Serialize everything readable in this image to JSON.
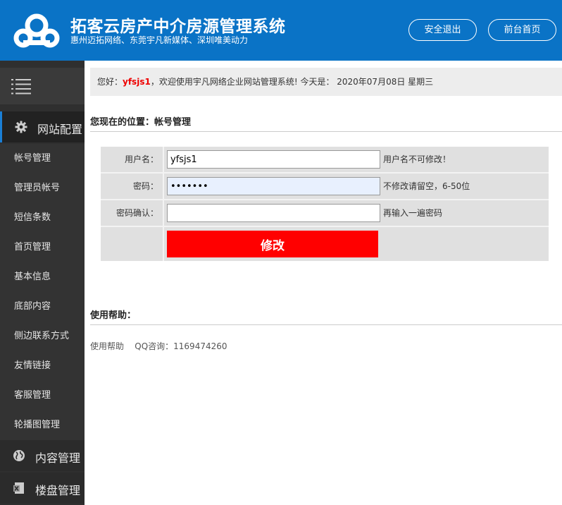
{
  "header": {
    "title": "拓客云房产中介房源管理系统",
    "subtitle": "惠州迈拓网络、东莞宇凡新媒体、深圳唯美动力",
    "logout_label": "安全退出",
    "home_label": "前台首页",
    "logo_icon": "cloud-logo-icon",
    "bg_color": "#0a73c6"
  },
  "sidebar": {
    "menu_icon": "hamburger-menu-icon",
    "config_section": {
      "label": "网站配置",
      "icon": "gear-icon"
    },
    "items": [
      {
        "label": "帐号管理"
      },
      {
        "label": "管理员帐号"
      },
      {
        "label": "短信条数"
      },
      {
        "label": "首页管理"
      },
      {
        "label": "基本信息"
      },
      {
        "label": "底部内容"
      },
      {
        "label": "侧边联系方式"
      },
      {
        "label": "友情链接"
      },
      {
        "label": "客服管理"
      },
      {
        "label": "轮播图管理"
      }
    ],
    "content_section": {
      "label": "内容管理",
      "icon": "globe-icon"
    },
    "building_section": {
      "label": "楼盘管理",
      "icon": "excel-icon"
    }
  },
  "welcome": {
    "prefix": "您好：",
    "username": "yfsjs1",
    "message": "，欢迎使用宇凡网络企业网站管理系统! 今天是： 2020年07月08日 星期三"
  },
  "location": "您现在的位置：帐号管理",
  "form": {
    "username_label": "用户名：",
    "username_value": "yfsjs1",
    "username_hint": "用户名不可修改！",
    "password_label": "密码：",
    "password_value": "•••••••",
    "password_hint": "不修改请留空，6-50位",
    "confirm_label": "密码确认：",
    "confirm_value": "",
    "confirm_hint": "再输入一遍密码",
    "submit_label": "修改",
    "submit_color": "#ff0000"
  },
  "help": {
    "title": "使用帮助：",
    "text": "使用帮助    QQ咨询：1169474260"
  }
}
